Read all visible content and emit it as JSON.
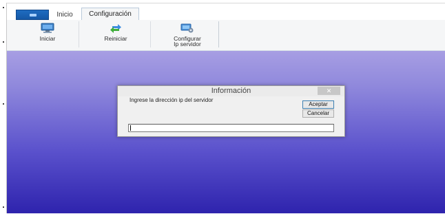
{
  "tabs": [
    {
      "label": "Inicio"
    },
    {
      "label": "Configuración",
      "selected": true
    }
  ],
  "ribbon": {
    "buttons": [
      {
        "label": "Iniciar",
        "icon": "monitor-icon"
      },
      {
        "label": "Reiniciar",
        "icon": "refresh-arrows-icon"
      },
      {
        "label_line1": "Configurar",
        "label_line2": "Ip servidor",
        "icon": "network-config-icon"
      }
    ]
  },
  "dialog": {
    "title": "Información",
    "close": "✕",
    "prompt": "Ingrese la dirección ip del servidor",
    "ok_label": "Aceptar",
    "cancel_label": "Cancelar",
    "input_value": ""
  },
  "colors": {
    "app_button": "#1f6cc0",
    "background_top": "#a79ee3",
    "background_bottom": "#2e23ad",
    "dialog_bg": "#f0f0f0",
    "default_button_border": "#3c7fb1"
  }
}
